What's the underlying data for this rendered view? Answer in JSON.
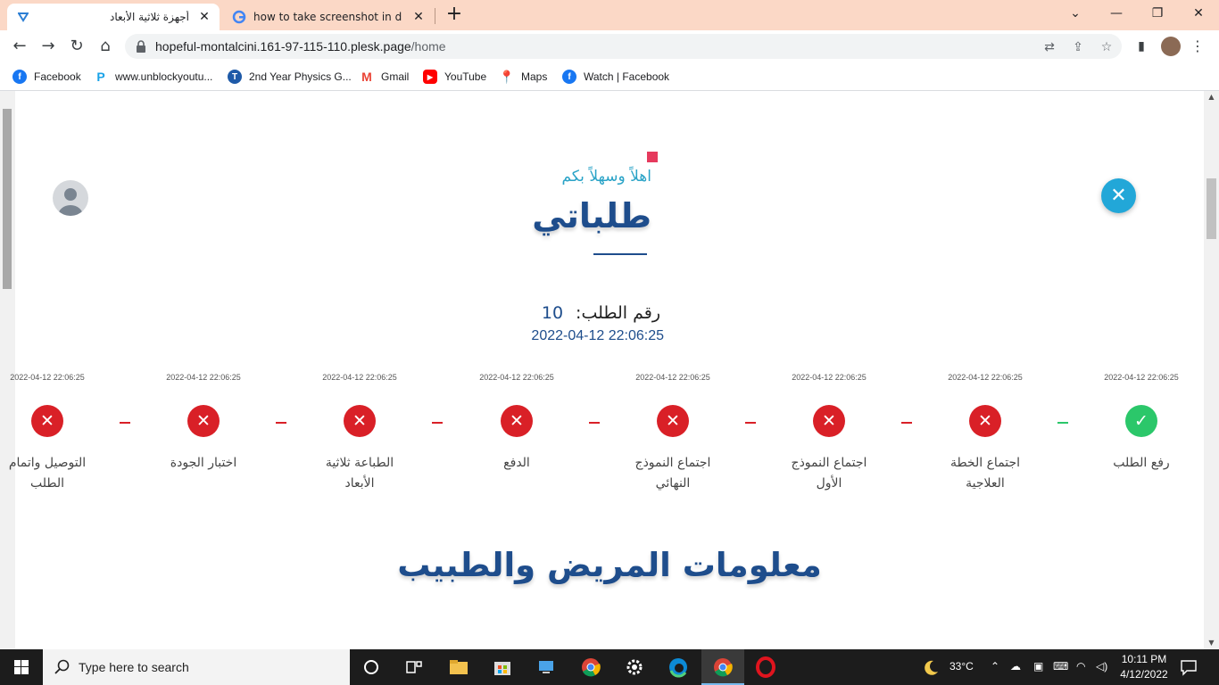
{
  "browser": {
    "tabs": [
      {
        "title": "أجهزة ثلاثية الأبعاد",
        "active": true
      },
      {
        "title": "how to take screenshot in dell lap",
        "active": false
      }
    ],
    "url_host": "hopeful-montalcini.161-97-115-110.plesk.page",
    "url_path": "/home",
    "bookmarks": [
      {
        "label": "Facebook",
        "icon": "facebook-icon",
        "color": "#1877f2"
      },
      {
        "label": "www.unblockyoutu...",
        "icon": "p-icon",
        "color": "#1aa3e8"
      },
      {
        "label": "2nd Year Physics G...",
        "icon": "t-icon",
        "color": "#1e5aa8"
      },
      {
        "label": "Gmail",
        "icon": "gmail-icon",
        "color": "#ea4335"
      },
      {
        "label": "YouTube",
        "icon": "youtube-icon",
        "color": "#ff0000"
      },
      {
        "label": "Maps",
        "icon": "maps-icon",
        "color": "#34a853"
      },
      {
        "label": "Watch | Facebook",
        "icon": "facebook-icon",
        "color": "#1877f2"
      }
    ]
  },
  "page": {
    "welcome": "اهلاً وسهلاً بكم",
    "title": "طلباتي",
    "order_label": "رقم الطلب:",
    "order_number": "10",
    "order_datetime": "2022-04-12 22:06:25",
    "steps": [
      {
        "label": "رفع الطلب",
        "date": "2022-04-12 22:06:25",
        "status": "done"
      },
      {
        "label": "اجتماع الخطة العلاجية",
        "date": "2022-04-12 22:06:25",
        "status": "pending"
      },
      {
        "label": "اجتماع النموذج الأول",
        "date": "2022-04-12 22:06:25",
        "status": "pending"
      },
      {
        "label": "اجتماع النموذج النهائي",
        "date": "2022-04-12 22:06:25",
        "status": "pending"
      },
      {
        "label": "الدفع",
        "date": "2022-04-12 22:06:25",
        "status": "pending"
      },
      {
        "label": "الطباعة ثلاثية الأبعاد",
        "date": "2022-04-12 22:06:25",
        "status": "pending"
      },
      {
        "label": "اختبار الجودة",
        "date": "2022-04-12 22:06:25",
        "status": "pending"
      },
      {
        "label": "التوصيل واتمام الطلب",
        "date": "2022-04-12 22:06:25",
        "status": "pending"
      }
    ],
    "section_title": "معلومات المريض والطبيب",
    "colors": {
      "primary": "#1e4d8c",
      "accent": "#2aa3c7",
      "done": "#2bc76a",
      "pending": "#d92027"
    }
  },
  "taskbar": {
    "search_placeholder": "Type here to search",
    "temperature": "33°C",
    "time": "10:11 PM",
    "date": "4/12/2022"
  }
}
